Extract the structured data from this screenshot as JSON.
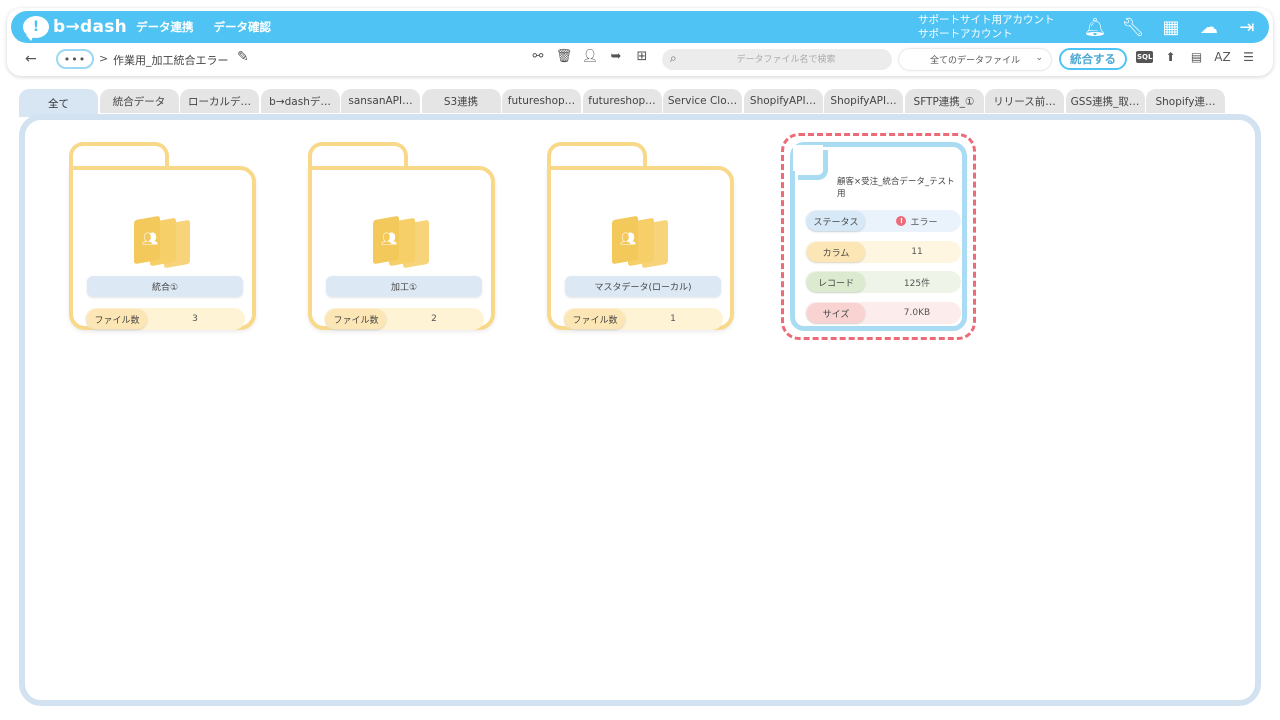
{
  "header": {
    "logo_text": "b→dash",
    "nav": [
      "データ連携",
      "データ確認"
    ],
    "account_line1": "サポートサイト用アカウント",
    "account_line2": "サポートアカウント",
    "icons": [
      "bell-icon",
      "wrench-icon",
      "grid-icon",
      "chat-icon",
      "logout-icon"
    ]
  },
  "subbar": {
    "back": "←",
    "more": "•••",
    "crumb_sep": ">",
    "breadcrumb": "作業用_加工統合エラー",
    "search_placeholder": "データファイル名で検索",
    "filter_value": "全てのデータファイル",
    "integrate_label": "統合する",
    "sql_label": "SQL",
    "sort_label": "AZ"
  },
  "tabs": [
    "全て",
    "統合データ",
    "ローカルデ…",
    "b→dashデ…",
    "sansanAPI…",
    "S3連携",
    "futureshop…",
    "futureshop…",
    "Service Clo…",
    "ShopifyAPI…",
    "ShopifyAPI…",
    "SFTP連携_①",
    "リリース前…",
    "GSS連携_取…",
    "Shopify連…"
  ],
  "folders": [
    {
      "name": "統合①",
      "count_label": "ファイル数",
      "count": "3"
    },
    {
      "name": "加工①",
      "count_label": "ファイル数",
      "count": "2"
    },
    {
      "name": "マスタデータ(ローカル)",
      "count_label": "ファイル数",
      "count": "1"
    }
  ],
  "file": {
    "title": "顧客×受注_統合データ_テスト用",
    "status_label": "ステータス",
    "status_value": "エラー",
    "column_label": "カラム",
    "column_value": "11",
    "record_label": "レコード",
    "record_value": "125件",
    "size_label": "サイズ",
    "size_value": "7.0KB"
  },
  "colors": {
    "accent": "#4fc4f4",
    "folder": "#f8d98a",
    "error": "#ec6b79"
  }
}
